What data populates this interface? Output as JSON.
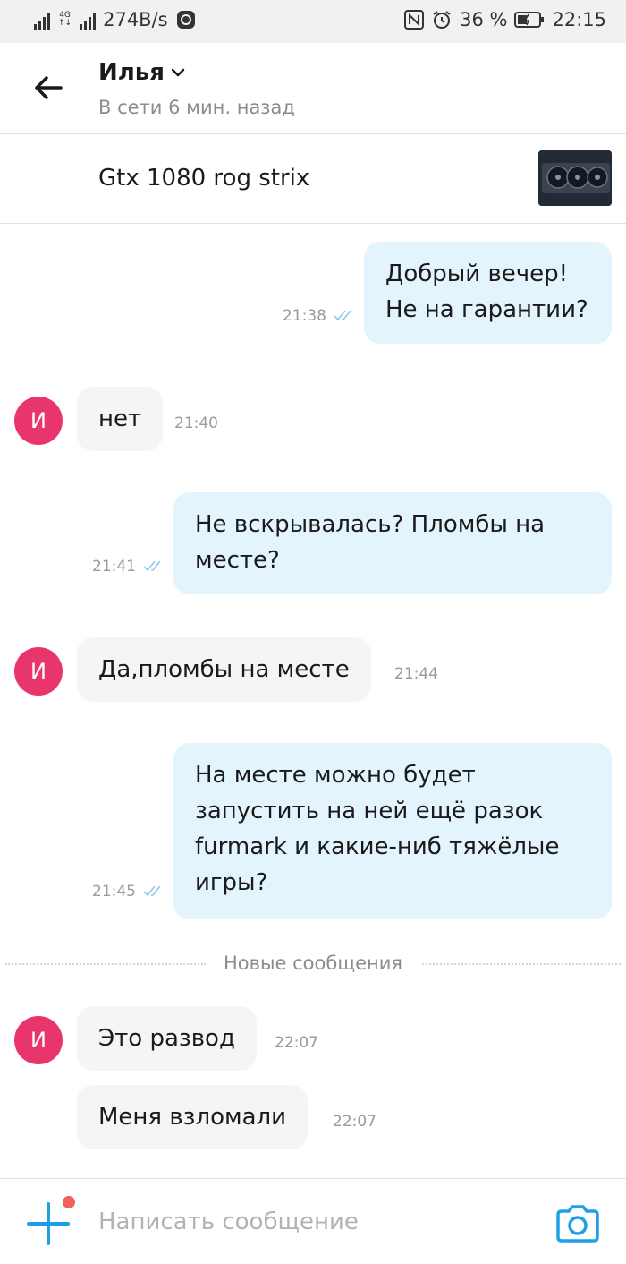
{
  "status_bar": {
    "network_type": "4G",
    "network_speed": "274B/s",
    "battery_percent": "36 %",
    "clock": "22:15"
  },
  "header": {
    "contact_name": "Илья",
    "last_seen": "В сети 6 мин. назад"
  },
  "item": {
    "title": "Gtx 1080 rog strix"
  },
  "messages": [
    {
      "direction": "out",
      "text": "Добрый вечер!\nНе на гарантии?",
      "time": "21:38"
    },
    {
      "direction": "in",
      "avatar": "И",
      "text": "нет",
      "time": "21:40"
    },
    {
      "direction": "out",
      "text": "Не вскрывалась? Пломбы на\nместе?",
      "time": "21:41"
    },
    {
      "direction": "in",
      "avatar": "И",
      "text": "Да,пломбы на месте",
      "time": "21:44"
    },
    {
      "direction": "out",
      "text": "На месте можно будет\nзапустить на ней ещё разок\nfurmark и какие-ниб тяжёлые\nигры?",
      "time": "21:45"
    },
    {
      "direction": "in",
      "avatar": "И",
      "text": "Это развод",
      "time": "22:07"
    },
    {
      "direction": "in",
      "text": "Меня взломали",
      "time": "22:07"
    }
  ],
  "new_messages_divider": "Новые сообщения",
  "composer": {
    "placeholder": "Написать сообщение"
  },
  "colors": {
    "accent": "#1ea0e6",
    "outgoing_bubble": "#e3f4fd",
    "incoming_bubble": "#f5f5f5",
    "avatar": "#e8366d",
    "notification_dot": "#f0605f"
  }
}
